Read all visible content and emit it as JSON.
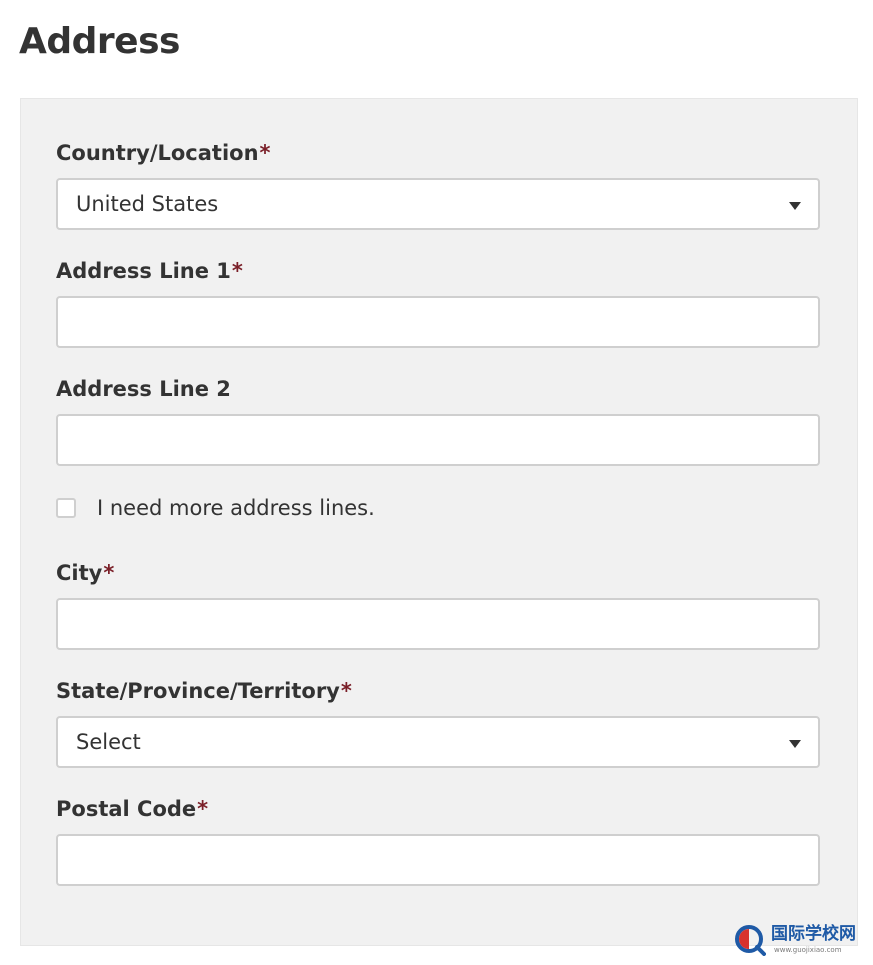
{
  "page": {
    "title": "Address"
  },
  "form": {
    "required_marker": "*",
    "country": {
      "label": "Country/Location",
      "value": "United States"
    },
    "address_line_1": {
      "label": "Address Line 1",
      "value": ""
    },
    "address_line_2": {
      "label": "Address Line 2",
      "value": ""
    },
    "more_lines": {
      "label": "I need more address lines.",
      "checked": false
    },
    "city": {
      "label": "City",
      "value": ""
    },
    "state": {
      "label": "State/Province/Territory",
      "value": "Select"
    },
    "postal_code": {
      "label": "Postal Code",
      "value": ""
    }
  },
  "icons": {
    "select_arrow": "chevron-down-icon",
    "watermark_logo": "magnifier-logo-icon"
  },
  "colors": {
    "panel_background": "#f1f1f1",
    "text": "#333333",
    "required_marker": "#7a1f28",
    "control_border": "#cfcfcf",
    "watermark_blue": "#1f5aa6",
    "watermark_red": "#d8322d"
  },
  "watermark": {
    "text": "国际学校网",
    "subtext": "www.guojixiao.com"
  }
}
